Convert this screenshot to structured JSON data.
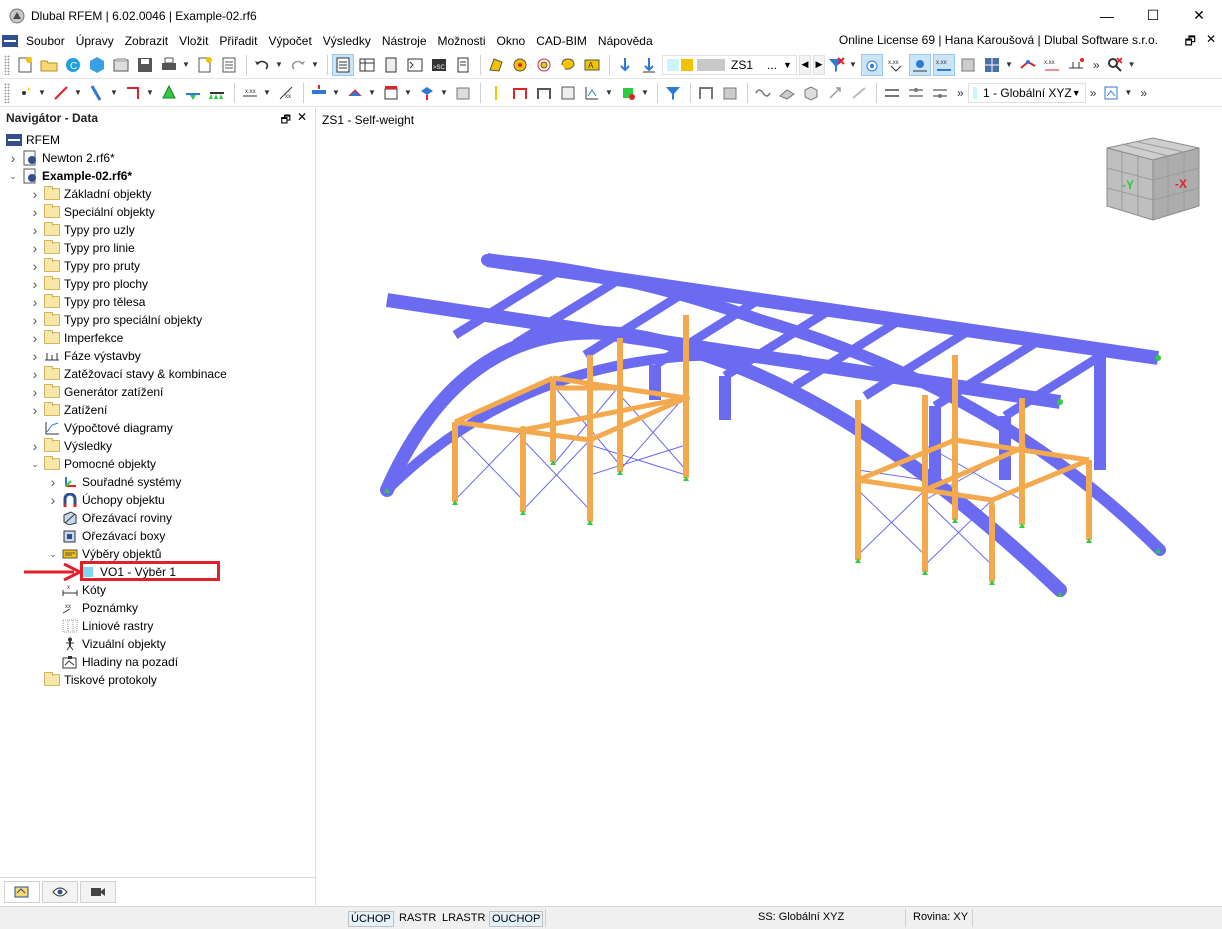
{
  "window": {
    "title": "Dlubal RFEM | 6.02.0046 | Example-02.rf6",
    "minimize": "—",
    "maximize": "☐",
    "close": "✕"
  },
  "menubar": {
    "items": [
      "Soubor",
      "Úpravy",
      "Zobrazit",
      "Vložit",
      "Přiřadit",
      "Výpočet",
      "Výsledky",
      "Nástroje",
      "Možnosti",
      "Okno",
      "CAD-BIM",
      "Nápověda"
    ],
    "license": "Online License 69 | Hana Karoušová | Dlubal Software s.r.o.",
    "mdi_restore": "🗗",
    "mdi_close": "✕"
  },
  "toolbar": {
    "load_case": "ZS1",
    "load_case_more": "...",
    "more": "»",
    "coord_system": "1 - Globální XYZ"
  },
  "navigator": {
    "title": "Navigátor - Data",
    "pin": "🗗",
    "close": "✕",
    "root": "RFEM",
    "items": [
      {
        "label": "Newton 2.rf6*",
        "level": 0,
        "twisty": ">",
        "icon": "model-icon"
      },
      {
        "label": "Example-02.rf6*",
        "level": 0,
        "twisty": "v",
        "icon": "model-icon",
        "bold": true
      },
      {
        "label": "Základní objekty",
        "level": 1,
        "twisty": ">",
        "icon": "folder-icon"
      },
      {
        "label": "Speciální objekty",
        "level": 1,
        "twisty": ">",
        "icon": "folder-icon"
      },
      {
        "label": "Typy pro uzly",
        "level": 1,
        "twisty": ">",
        "icon": "folder-icon"
      },
      {
        "label": "Typy pro linie",
        "level": 1,
        "twisty": ">",
        "icon": "folder-icon"
      },
      {
        "label": "Typy pro pruty",
        "level": 1,
        "twisty": ">",
        "icon": "folder-icon"
      },
      {
        "label": "Typy pro plochy",
        "level": 1,
        "twisty": ">",
        "icon": "folder-icon"
      },
      {
        "label": "Typy pro tělesa",
        "level": 1,
        "twisty": ">",
        "icon": "folder-icon"
      },
      {
        "label": "Typy pro speciální objekty",
        "level": 1,
        "twisty": ">",
        "icon": "folder-icon"
      },
      {
        "label": "Imperfekce",
        "level": 1,
        "twisty": ">",
        "icon": "folder-icon"
      },
      {
        "label": "Fáze výstavby",
        "level": 1,
        "twisty": ">",
        "icon": "construction-stage-icon"
      },
      {
        "label": "Zatěžovací stavy & kombinace",
        "level": 1,
        "twisty": ">",
        "icon": "folder-icon"
      },
      {
        "label": "Generátor zatížení",
        "level": 1,
        "twisty": ">",
        "icon": "folder-icon"
      },
      {
        "label": "Zatížení",
        "level": 1,
        "twisty": ">",
        "icon": "folder-icon"
      },
      {
        "label": "Výpočtové diagramy",
        "level": 1,
        "twisty": "",
        "icon": "diagram-icon"
      },
      {
        "label": "Výsledky",
        "level": 1,
        "twisty": ">",
        "icon": "folder-icon"
      },
      {
        "label": "Pomocné objekty",
        "level": 1,
        "twisty": "v",
        "icon": "folder-icon"
      },
      {
        "label": "Souřadné systémy",
        "level": 2,
        "twisty": ">",
        "icon": "coordinate-system-icon"
      },
      {
        "label": "Úchopy objektu",
        "level": 2,
        "twisty": ">",
        "icon": "magnet-icon"
      },
      {
        "label": "Ořezávací roviny",
        "level": 2,
        "twisty": "",
        "icon": "clipping-plane-icon"
      },
      {
        "label": "Ořezávací boxy",
        "level": 2,
        "twisty": "",
        "icon": "clipping-box-icon"
      },
      {
        "label": "Výběry objektů",
        "level": 2,
        "twisty": "v",
        "icon": "object-selection-icon"
      },
      {
        "label": "VO1 - Výběr 1",
        "level": 3,
        "twisty": "",
        "icon": "selection-color-icon"
      },
      {
        "label": "Kóty",
        "level": 2,
        "twisty": "",
        "icon": "dimension-icon"
      },
      {
        "label": "Poznámky",
        "level": 2,
        "twisty": "",
        "icon": "note-icon"
      },
      {
        "label": "Liniové rastry",
        "level": 2,
        "twisty": "",
        "icon": "line-grid-icon"
      },
      {
        "label": "Vizuální objekty",
        "level": 2,
        "twisty": "",
        "icon": "visual-object-icon"
      },
      {
        "label": "Hladiny na pozadí",
        "level": 2,
        "twisty": "",
        "icon": "background-layer-icon"
      },
      {
        "label": "Tiskové protokoly",
        "level": 1,
        "twisty": "",
        "icon": "folder-icon"
      }
    ]
  },
  "viewport": {
    "label": "ZS1 - Self-weight",
    "view_cube": {
      "left_face": "-Y",
      "right_face": "-X"
    },
    "colors": {
      "beams": "#6b6bf2",
      "columns": "#f3a94e",
      "supports": "#2ecc40",
      "bracing": "#6b6bf2"
    }
  },
  "statusbar": {
    "toggles": [
      "ÚCHOP",
      "RASTR",
      "LRASTR",
      "OUCHOP"
    ],
    "coord_system": "SS: Globální XYZ",
    "plane": "Rovina: XY"
  }
}
